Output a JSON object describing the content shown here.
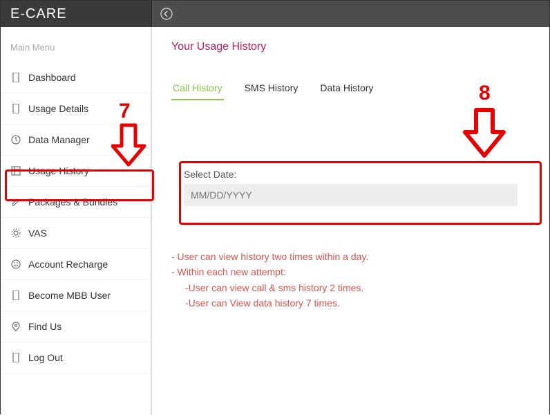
{
  "header": {
    "brand": "E-CARE"
  },
  "sidebar": {
    "heading": "Main Menu",
    "items": [
      {
        "label": "Dashboard",
        "icon": "phone-icon"
      },
      {
        "label": "Usage Details",
        "icon": "phone-icon"
      },
      {
        "label": "Data Manager",
        "icon": "clock-icon"
      },
      {
        "label": "Usage History",
        "icon": "grid-icon"
      },
      {
        "label": "Packages & Bundles",
        "icon": "edit-icon"
      },
      {
        "label": "VAS",
        "icon": "gear-icon"
      },
      {
        "label": "Account Recharge",
        "icon": "smile-icon"
      },
      {
        "label": "Become MBB User",
        "icon": "phone-icon"
      },
      {
        "label": "Find Us",
        "icon": "pin-icon"
      },
      {
        "label": "Log Out",
        "icon": "phone-icon"
      }
    ]
  },
  "main": {
    "title": "Your Usage History",
    "tabs": [
      {
        "label": "Call History",
        "active": true
      },
      {
        "label": "SMS History",
        "active": false
      },
      {
        "label": "Data History",
        "active": false
      }
    ],
    "date": {
      "label": "Select Date:",
      "placeholder": "MM/DD/YYYY",
      "value": ""
    },
    "info": {
      "line1": "- User can view history two times within a day.",
      "line2": "- Within each new attempt:",
      "line3": "-User can view call & sms history 2 times.",
      "line4": "-User can View data history 7 times."
    }
  },
  "annotations": {
    "n7": "7",
    "n8": "8"
  }
}
